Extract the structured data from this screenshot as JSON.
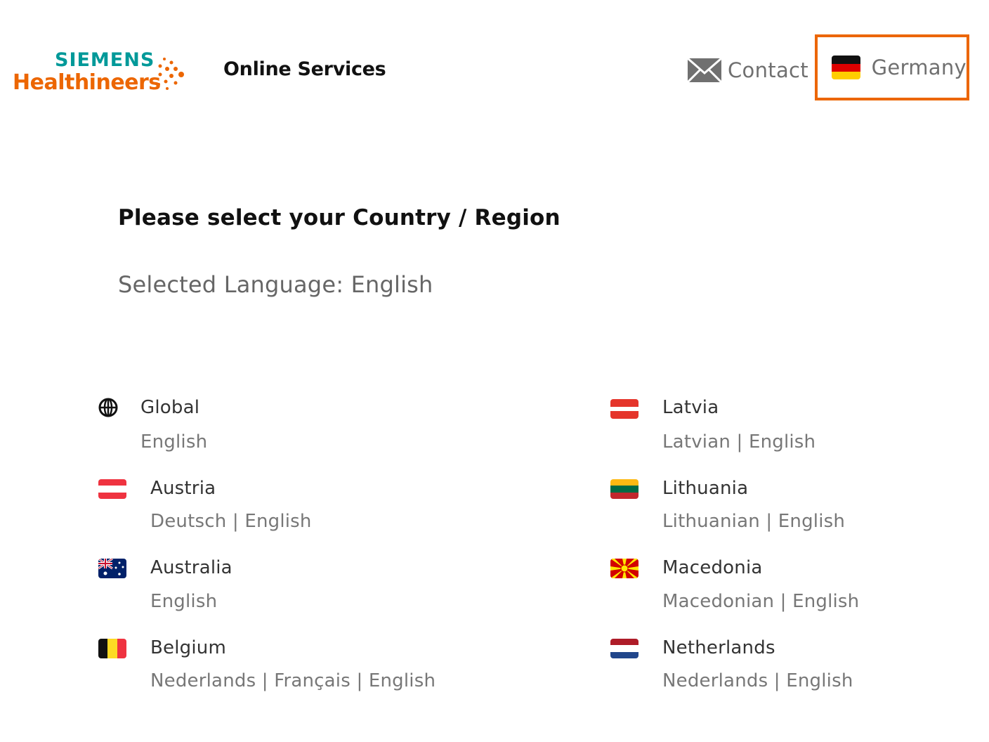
{
  "header": {
    "logo_line1": "SIEMENS",
    "logo_line2": "Healthineers",
    "brand_title": "Online Services",
    "contact_label": "Contact",
    "country_label": "Germany",
    "accent_color": "#ec6602",
    "teal_color": "#009999"
  },
  "main": {
    "title": "Please select your Country / Region",
    "selected_language_prefix": "Selected Language: ",
    "selected_language": "English"
  },
  "countries_left": [
    {
      "name": "Global",
      "icon": "globe-icon",
      "languages": [
        "English"
      ]
    },
    {
      "name": "Austria",
      "icon": "austria-flag-icon",
      "languages": [
        "Deutsch",
        "English"
      ]
    },
    {
      "name": "Australia",
      "icon": "australia-flag-icon",
      "languages": [
        "English"
      ]
    },
    {
      "name": "Belgium",
      "icon": "belgium-flag-icon",
      "languages": [
        "Nederlands",
        "Français",
        "English"
      ]
    }
  ],
  "countries_right": [
    {
      "name": "Latvia",
      "icon": "latvia-flag-icon",
      "languages": [
        "Latvian",
        "English"
      ]
    },
    {
      "name": "Lithuania",
      "icon": "lithuania-flag-icon",
      "languages": [
        "Lithuanian",
        "English"
      ]
    },
    {
      "name": "Macedonia",
      "icon": "macedonia-flag-icon",
      "languages": [
        "Macedonian",
        "English"
      ]
    },
    {
      "name": "Netherlands",
      "icon": "netherlands-flag-icon",
      "languages": [
        "Nederlands",
        "English"
      ]
    }
  ]
}
